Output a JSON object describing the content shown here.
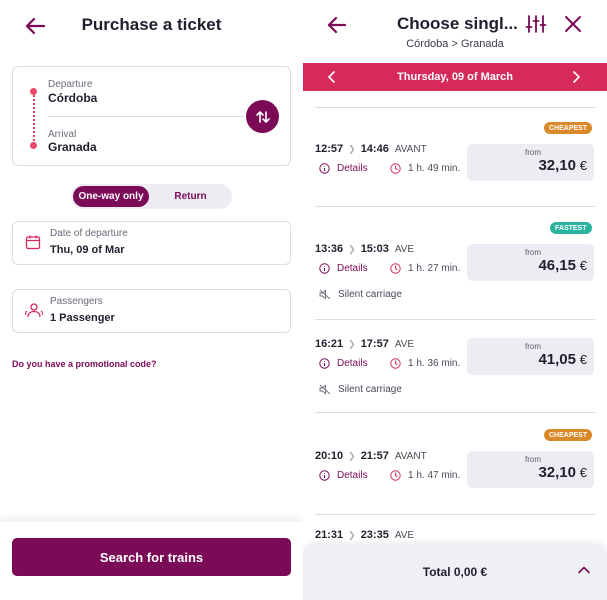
{
  "left": {
    "title": "Purchase a ticket",
    "departure_label": "Departure",
    "departure_value": "Córdoba",
    "arrival_label": "Arrival",
    "arrival_value": "Granada",
    "trip_type": {
      "one_way": "One-way only",
      "return": "Return",
      "selected": "One-way only"
    },
    "date_label": "Date of departure",
    "date_value": "Thu, 09 of Mar",
    "passengers_label": "Passengers",
    "passengers_value": "1 Passenger",
    "promo_link": "Do you have a promotional code?",
    "search_button": "Search for trains"
  },
  "right": {
    "title": "Choose singl...",
    "route": "Córdoba > Granada",
    "date": "Thursday, 09 of March",
    "details_label": "Details",
    "from_label": "from",
    "currency": "€",
    "silent_label": "Silent carriage",
    "trips": [
      {
        "depart": "12:57",
        "arrive": "14:46",
        "type": "AVANT",
        "duration": "1 h. 49 min.",
        "price": "32,10",
        "badge": "CHEAPEST",
        "silent": false
      },
      {
        "depart": "13:36",
        "arrive": "15:03",
        "type": "AVE",
        "duration": "1 h. 27 min.",
        "price": "46,15",
        "badge": "FASTEST",
        "silent": true
      },
      {
        "depart": "16:21",
        "arrive": "17:57",
        "type": "AVE",
        "duration": "1 h. 36 min.",
        "price": "41,05",
        "badge": "",
        "silent": true
      },
      {
        "depart": "20:10",
        "arrive": "21:57",
        "type": "AVANT",
        "duration": "1 h. 47 min.",
        "price": "32,10",
        "badge": "CHEAPEST",
        "silent": false
      },
      {
        "depart": "21:31",
        "arrive": "23:35",
        "type": "AVE"
      }
    ],
    "total": "Total 0,00 €"
  },
  "colors": {
    "brand": "#7b0a57",
    "date_bar": "#d62a5a",
    "cheapest": "#d9892a",
    "fastest": "#2bb5a0",
    "route_dots": "#e8496a"
  }
}
